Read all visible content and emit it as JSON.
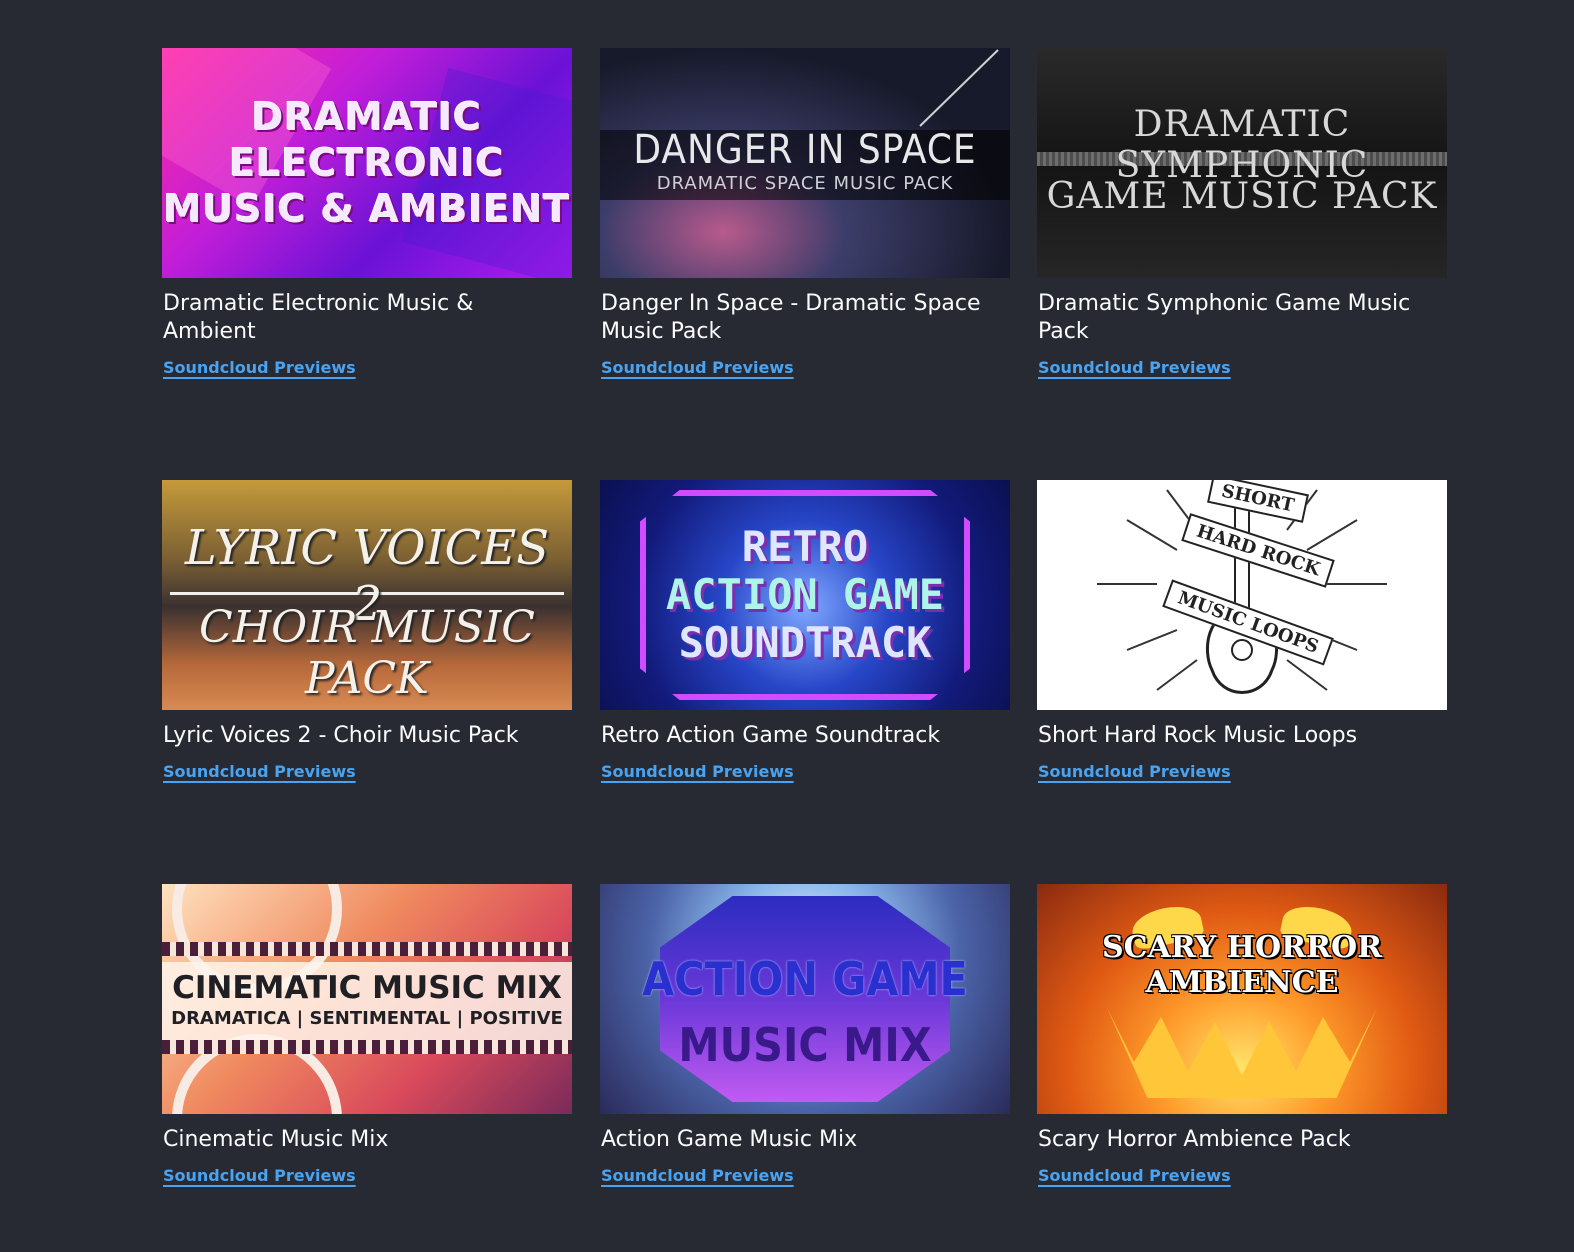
{
  "cards": [
    {
      "title": "Dramatic Electronic Music & Ambient",
      "link": "Soundcloud Previews",
      "thumb": {
        "lines": [
          "DRAMATIC",
          "ELECTRONIC",
          "MUSIC & AMBIENT"
        ]
      }
    },
    {
      "title": "Danger In Space - Dramatic Space Music Pack",
      "link": "Soundcloud Previews",
      "thumb": {
        "lines": [
          "DANGER IN SPACE",
          "DRAMATIC SPACE MUSIC PACK"
        ]
      }
    },
    {
      "title": "Dramatic Symphonic Game Music Pack",
      "link": "Soundcloud Previews",
      "thumb": {
        "lines": [
          "DRAMATIC SYMPHONIC",
          "GAME MUSIC PACK"
        ]
      }
    },
    {
      "title": "Lyric Voices 2 - Choir Music Pack",
      "link": "Soundcloud Previews",
      "thumb": {
        "lines": [
          "LYRIC VOICES 2",
          "CHOIR MUSIC PACK"
        ]
      }
    },
    {
      "title": "Retro Action Game Soundtrack",
      "link": "Soundcloud Previews",
      "thumb": {
        "lines": [
          "RETRO",
          "ACTION GAME",
          "SOUNDTRACK"
        ]
      }
    },
    {
      "title": "Short Hard Rock Music Loops",
      "link": "Soundcloud Previews",
      "thumb": {
        "lines": [
          "SHORT",
          "HARD ROCK",
          "MUSIC LOOPS"
        ]
      }
    },
    {
      "title": "Cinematic Music Mix",
      "link": "Soundcloud Previews",
      "thumb": {
        "lines": [
          "CINEMATIC MUSIC MIX",
          "DRAMATICA | SENTIMENTAL | POSITIVE"
        ]
      }
    },
    {
      "title": "Action Game Music Mix",
      "link": "Soundcloud Previews",
      "thumb": {
        "lines": [
          "ACTION GAME",
          "MUSIC MIX"
        ]
      }
    },
    {
      "title": "Scary Horror Ambience Pack",
      "link": "Soundcloud Previews",
      "thumb": {
        "lines": [
          "SCARY HORROR AMBIENCE"
        ]
      }
    }
  ],
  "colors": {
    "background": "#272a33",
    "link": "#4aa3f0",
    "title": "#fbfbfb"
  }
}
